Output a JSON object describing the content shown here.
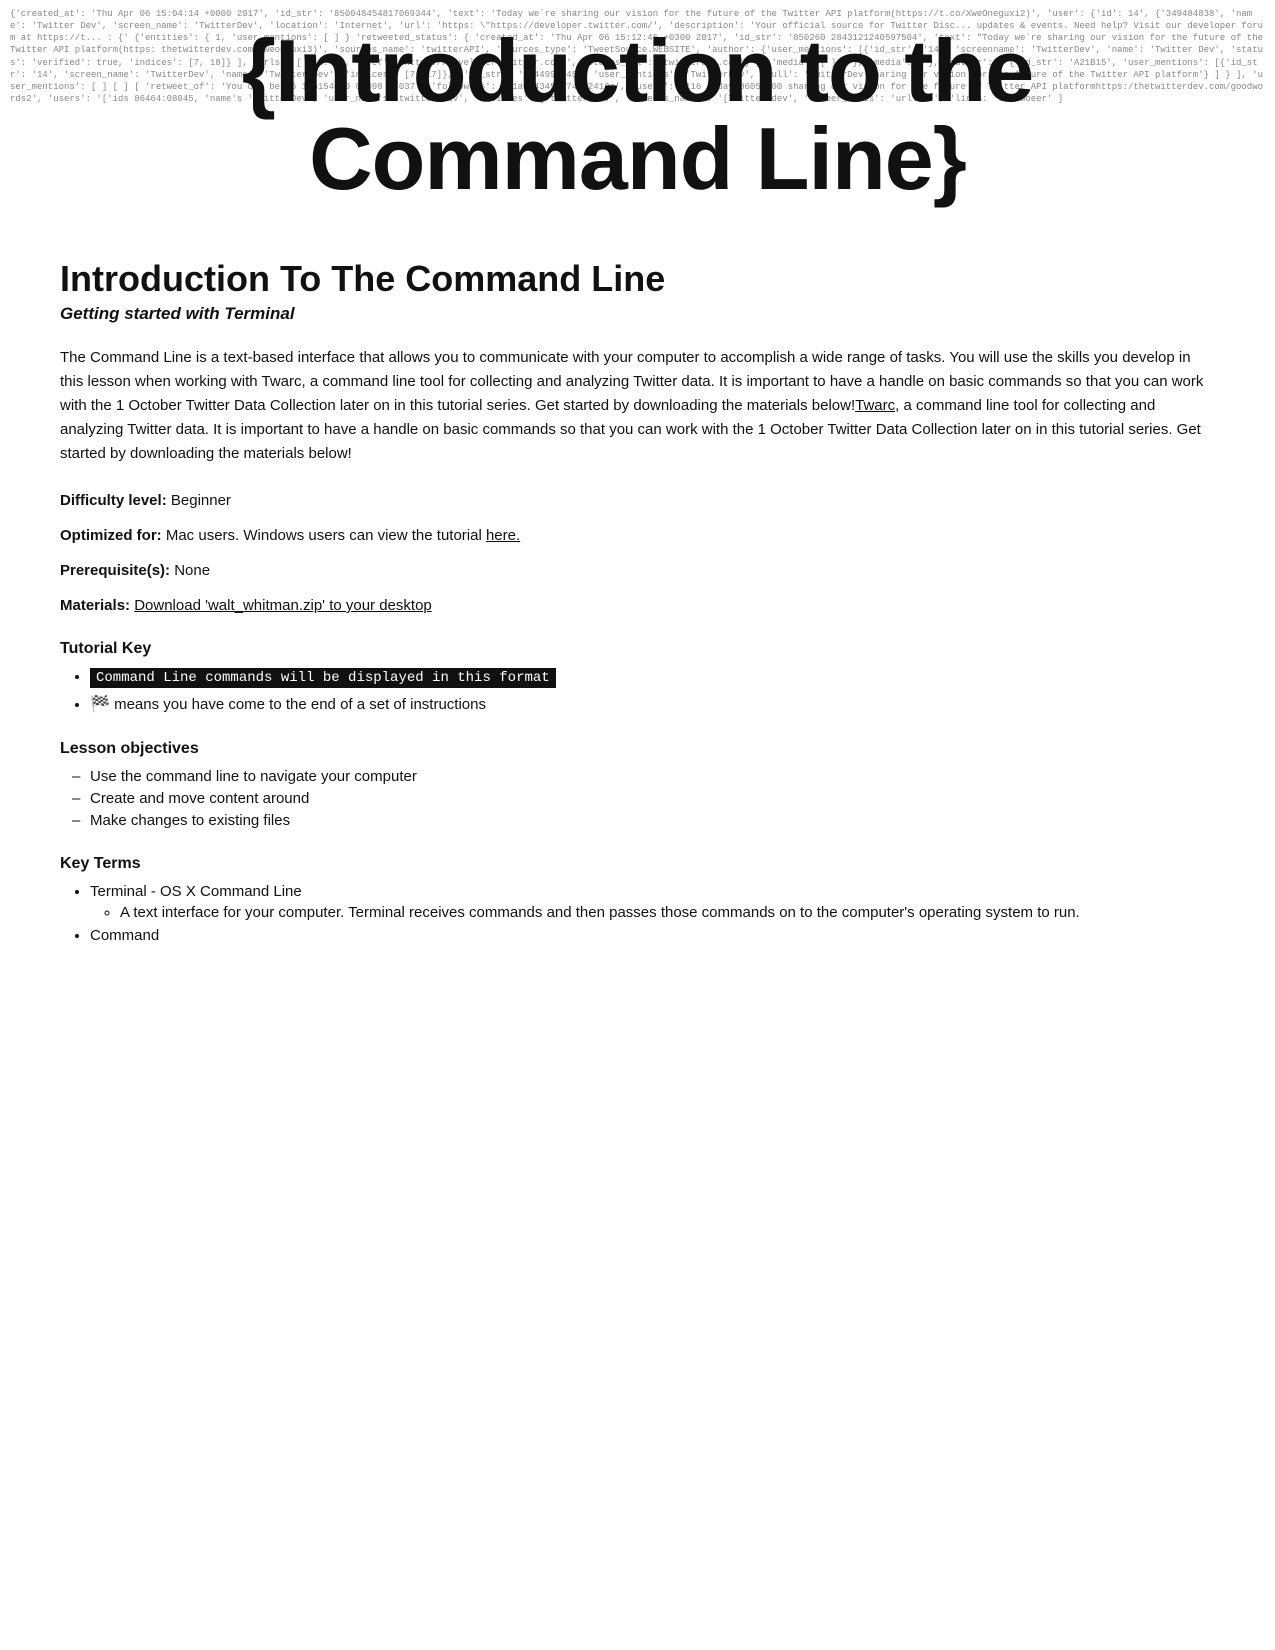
{
  "hero": {
    "background_text": "{'created_at': 'Thu Apr 06 15:04:14 +0000 2017', 'id_str': '850048454817069344', 'text': 'Today weʼre sharing our vision for the future of the Twitter API platform(https://t.co/XweOneguxi2)', 'user': {'id': 14', {'349484838', 'name': 'Twitter Dev', 'screen_name': 'TwitterDev', 'location': 'Internet', 'url': 'https: \\\"https://developer.twitter.com/', 'description': 'Your official source for Twitter Disc... updates & events. Need help? Visit our developer forum at https://t... : {' {'entities': { 1, 'user_mentions': [ ] } 'retweeted_status': { 'created_at': 'Thu Apr 06 15:12:45 +0300 2017', 'id_str': '850260 2843121240597504', 'text': \"Today weʼre sharing our vision for the future of the Twitter API platform(https: thetwitterdev.com/Xweon9uxi3)', 'sources_name': 'twitterAPI', 'sources_type': 'TweetSource.WEBSITE', 'author': {'user_mentions': [{'id_str': '14', 'screenname': 'TwitterDev', 'name': 'Twitter Dev', 'status': 'verified': true, 'indices': [7, 18]} ], 'urls': [ {id: '', 'href': 'https://developer.twitter.com/', 'status_url': 'twitterapi.com'} ], 'media': [ ] } }, 'media': { }, 'author': { {'id_str': 'A21B15', 'user_mentions': [{'id_str': '14', 'screen_name': 'TwitterDev', 'name': 'Twitter Dev', 'indices': [7, 17]}, {'id_str': '2244994945', 'user_mentions': 'TwitterDev', 'full': 'TwitterDev sharing our vision for the future of the Twitter API platform'} ] } ],  'user_mentions': [ ] [ ] [ 'retweet_of': 'You can be 86 115154839 01098 07037', 'followers': '&1a0043455174312412c', 'users': '116 today 06056300 sharing our vision for the future of Twitter API platformhttps:/thetwitterdev.com/goodwords2', 'users': '['ids 86464:08045, 'name's 'TwitterDev', 'user_name's 'twitter_dev', 'entities': ['twitter_dev', 'twoeers_names': '[Twitter dev', 'twoeer_names': 'urlline', 'lines: 'it_twoeer' ]",
    "line1": "{Introduction to the",
    "line2": "Command Line}"
  },
  "page": {
    "title": "Introduction To The Command Line",
    "subtitle": "Getting started with Terminal",
    "intro": "The Command Line is a text-based interface that allows you to communicate with your computer to accomplish a wide range of tasks. You will use the skills you develop in this lesson when working with Twarc, a command line tool for collecting and analyzing Twitter data. It is important to have a handle on basic commands so that you can work with the 1 October Twitter Data Collection later on in this tutorial series. Get started by downloading the materials below!",
    "twarc_link_text": "Twarc",
    "difficulty_label": "Difficulty level:",
    "difficulty_value": "Beginner",
    "optimized_label": "Optimized for:",
    "optimized_value": "Mac users. Windows users can view the tutorial ",
    "optimized_link": "here.",
    "prerequisite_label": "Prerequisite(s):",
    "prerequisite_value": "None",
    "materials_label": "Materials:",
    "materials_link": "Download 'walt_whitman.zip' to your desktop",
    "tutorial_key_heading": "Tutorial Key",
    "tutorial_key_items": [
      {
        "type": "code",
        "text": "Command Line commands will be displayed in this format"
      },
      {
        "type": "text",
        "text": "🏁 means you have come to the end of a set of instructions"
      }
    ],
    "lesson_objectives_heading": "Lesson objectives",
    "lesson_objectives": [
      "Use the command line to navigate your computer",
      "Create and move content around",
      "Make changes to existing files"
    ],
    "key_terms_heading": "Key Terms",
    "key_terms": [
      {
        "term": "Terminal - OS X Command Line",
        "sub_items": [
          "A text interface for your computer. Terminal receives commands and then passes those commands on to the computer's operating system to run."
        ]
      },
      {
        "term": "Command",
        "sub_items": []
      }
    ]
  }
}
